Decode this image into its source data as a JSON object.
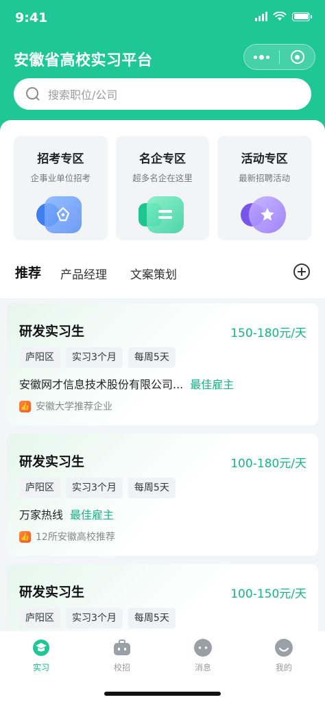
{
  "status": {
    "time": "9:41"
  },
  "header": {
    "title": "安徽省高校实习平台",
    "capsule": {
      "more_icon": "more-dots-icon",
      "close_icon": "target-close-icon"
    },
    "bg_color": "#1ec795"
  },
  "search": {
    "placeholder": "搜索职位/公司",
    "icon": "search-icon"
  },
  "zones": [
    {
      "title": "招考专区",
      "subtitle": "企事业单位招考",
      "icon": "pen-nib-icon",
      "color": "#4a8cf7"
    },
    {
      "title": "名企专区",
      "subtitle": "超多名企在这里",
      "icon": "building-icon",
      "color": "#2dd4a0"
    },
    {
      "title": "活动专区",
      "subtitle": "最新招聘活动",
      "icon": "star-icon",
      "color": "#8a6cf0"
    }
  ],
  "tabs": [
    {
      "label": "推荐",
      "active": true
    },
    {
      "label": "产品经理",
      "active": false
    },
    {
      "label": "文案策划",
      "active": false
    }
  ],
  "add_tab_icon": "plus-circle-icon",
  "jobs": [
    {
      "title": "研发实习生",
      "salary": "150-180元/天",
      "tags": [
        "庐阳区",
        "实习3个月",
        "每周5天"
      ],
      "company": "安徽网才信息技术股份有限公司...",
      "badge": "最佳雇主",
      "recommend": "安徽大学推荐企业"
    },
    {
      "title": "研发实习生",
      "salary": "100-180元/天",
      "tags": [
        "庐阳区",
        "实习3个月",
        "每周5天"
      ],
      "company": "万家热线",
      "badge": "最佳雇主",
      "recommend": "12所安徽高校推荐"
    },
    {
      "title": "研发实习生",
      "salary": "100-150元/天",
      "tags": [
        "庐阳区",
        "实习3个月",
        "每周5天"
      ],
      "company": "",
      "badge": "",
      "recommend": ""
    }
  ],
  "tabbar": [
    {
      "label": "实习",
      "icon": "graduation-cap-icon",
      "active": true
    },
    {
      "label": "校招",
      "icon": "briefcase-icon",
      "active": false
    },
    {
      "label": "消息",
      "icon": "chat-bubble-icon",
      "active": false
    },
    {
      "label": "我的",
      "icon": "profile-icon",
      "active": false
    }
  ],
  "colors": {
    "accent": "#16b483",
    "recommend_badge": "#f3552b"
  }
}
